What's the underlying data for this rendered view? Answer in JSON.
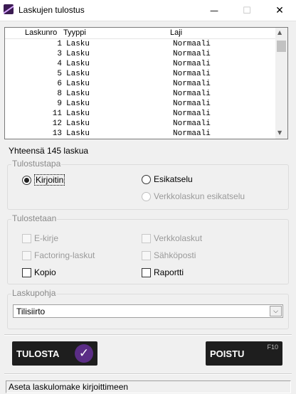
{
  "window": {
    "title": "Laskujen tulostus",
    "minimize": "—",
    "maximize": "☐",
    "close": "✕"
  },
  "list": {
    "columns": [
      "Laskunro",
      "Tyyppi",
      "Laji"
    ],
    "rows": [
      {
        "nro": "1",
        "tyyppi": "Lasku",
        "laji": "Normaali"
      },
      {
        "nro": "3",
        "tyyppi": "Lasku",
        "laji": "Normaali"
      },
      {
        "nro": "4",
        "tyyppi": "Lasku",
        "laji": "Normaali"
      },
      {
        "nro": "5",
        "tyyppi": "Lasku",
        "laji": "Normaali"
      },
      {
        "nro": "6",
        "tyyppi": "Lasku",
        "laji": "Normaali"
      },
      {
        "nro": "8",
        "tyyppi": "Lasku",
        "laji": "Normaali"
      },
      {
        "nro": "9",
        "tyyppi": "Lasku",
        "laji": "Normaali"
      },
      {
        "nro": "11",
        "tyyppi": "Lasku",
        "laji": "Normaali"
      },
      {
        "nro": "12",
        "tyyppi": "Lasku",
        "laji": "Normaali"
      },
      {
        "nro": "13",
        "tyyppi": "Lasku",
        "laji": "Normaali"
      }
    ],
    "scroll_up": "▲",
    "scroll_down": "▼"
  },
  "total_text": "Yhteensä 145 laskua",
  "print_mode": {
    "legend": "Tulostustapa",
    "printer": "Kirjoitin",
    "preview": "Esikatselu",
    "einvoice_preview": "Verkkolaskun esikatselu",
    "selected": "printer"
  },
  "printed": {
    "legend": "Tulostetaan",
    "ekirje": "E-kirje",
    "verkkolaskut": "Verkkolaskut",
    "factoring": "Factoring-laskut",
    "sahkoposti": "Sähköposti",
    "kopio": "Kopio",
    "raportti": "Raportti"
  },
  "template": {
    "legend": "Laskupohja",
    "value": "Tilisiirto",
    "dropdown_glyph": "⌵"
  },
  "buttons": {
    "print": "TULOSTA",
    "print_check": "✓",
    "exit": "POISTU",
    "exit_key": "F10"
  },
  "status": "Aseta laskulomake kirjoittimeen"
}
